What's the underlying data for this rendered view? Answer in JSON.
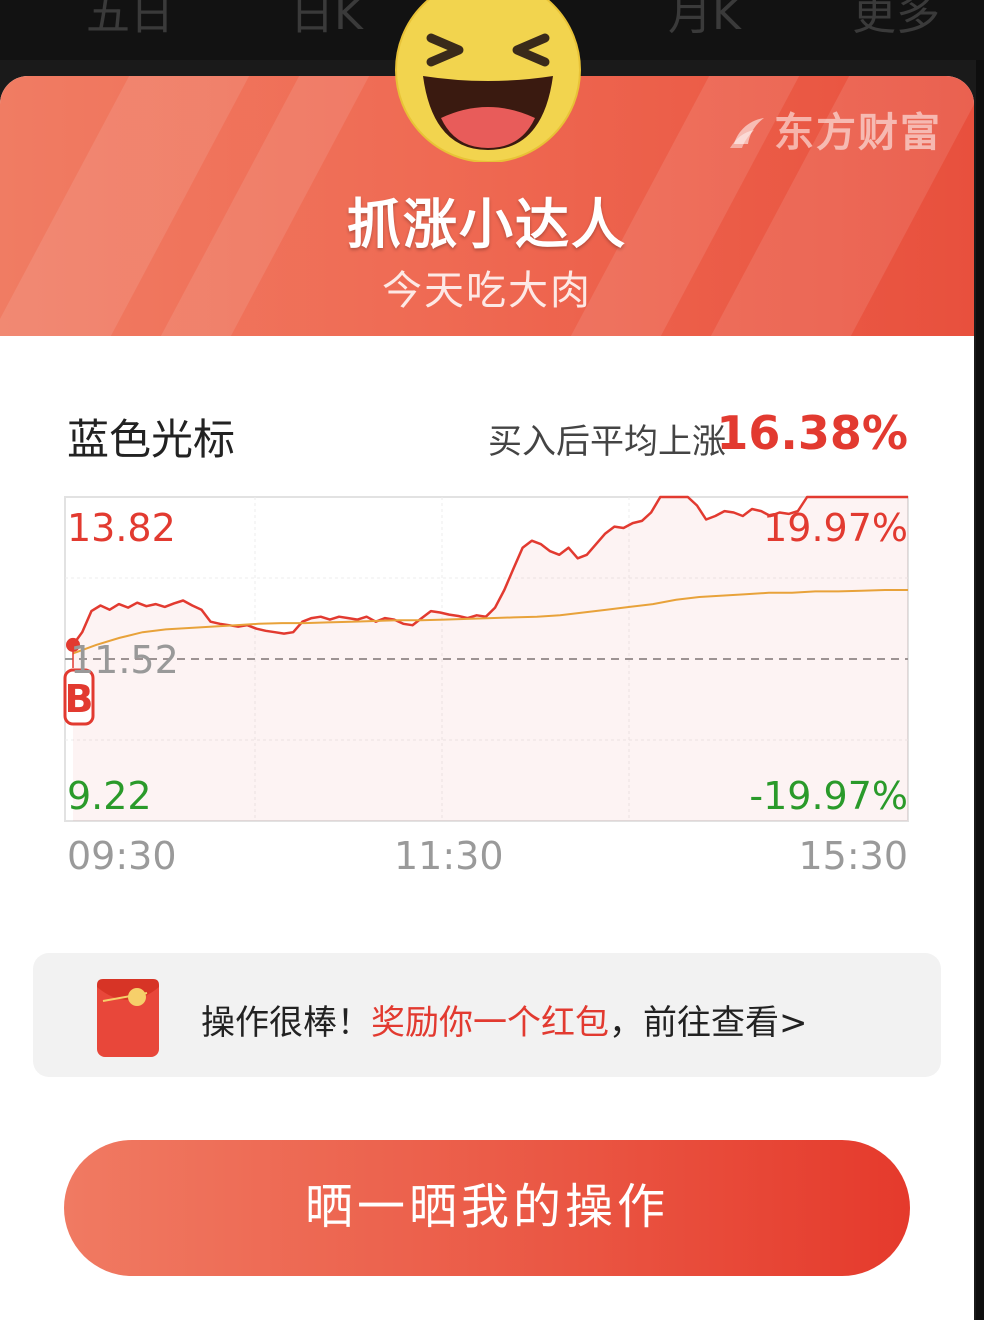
{
  "background_tabs": [
    "五日",
    "日K",
    "月K",
    "更多"
  ],
  "header": {
    "brand": "东方财富",
    "title": "抓涨小达人",
    "subtitle": "今天吃大肉"
  },
  "stock": {
    "name": "蓝色光标",
    "avg_rise_label": "买入后平均上涨",
    "avg_rise_value": "16.38%"
  },
  "chart_data": {
    "type": "line",
    "price_labels": {
      "high": "13.82",
      "base": "11.52",
      "low": "9.22"
    },
    "pct_labels": {
      "high": "19.97%",
      "low": "-19.97%"
    },
    "x_ticks": [
      "09:30",
      "11:30",
      "15:30"
    ],
    "buy_marker": "B",
    "ylim": [
      9.22,
      13.82
    ],
    "series": [
      {
        "values": [
          11.72,
          11.9,
          12.2,
          12.28,
          12.22,
          12.3,
          12.25,
          12.32,
          12.27,
          12.3,
          12.26,
          12.31,
          12.35,
          12.28,
          12.22,
          12.05,
          12.02,
          12.0,
          11.98,
          12.0,
          11.95,
          11.92,
          11.9,
          11.88,
          11.9,
          12.05,
          12.1,
          12.12,
          12.08,
          12.12,
          12.1,
          12.08,
          12.12,
          12.05,
          12.1,
          12.08,
          12.02,
          12.0,
          12.1,
          12.2,
          12.18,
          12.15,
          12.13,
          12.1,
          12.14,
          12.12,
          12.25,
          12.5,
          12.8,
          13.1,
          13.2,
          13.15,
          13.05,
          13.0,
          13.1,
          12.95,
          13.0,
          13.15,
          13.3,
          13.4,
          13.38,
          13.45,
          13.48,
          13.6,
          13.82,
          13.82,
          13.82,
          13.82,
          13.7,
          13.5,
          13.55,
          13.62,
          13.6,
          13.55,
          13.65,
          13.62,
          13.55,
          13.6,
          13.58,
          13.62,
          13.82,
          13.82,
          13.82,
          13.82,
          13.82,
          13.82,
          13.82,
          13.82,
          13.82,
          13.82,
          13.82,
          13.82
        ],
        "color": "#e23a30"
      },
      {
        "values": [
          11.6,
          11.72,
          11.82,
          11.9,
          11.94,
          11.96,
          11.98,
          12.0,
          12.02,
          12.03,
          12.03,
          12.04,
          12.05,
          12.06,
          12.07,
          12.07,
          12.08,
          12.09,
          12.1,
          12.11,
          12.12,
          12.14,
          12.18,
          12.22,
          12.26,
          12.3,
          12.36,
          12.4,
          12.42,
          12.44,
          12.46,
          12.46,
          12.48,
          12.48,
          12.49,
          12.5,
          12.5
        ],
        "color": "#e8a23a"
      }
    ]
  },
  "reward": {
    "part1": "操作很棒！",
    "part2": "奖励你一个红包",
    "part3": "，前往查看>"
  },
  "share_button": "晒一晒我的操作",
  "colors": {
    "accent": "#e23a30",
    "fall": "#2a9a2a",
    "header_start": "#f07c63",
    "header_end": "#e8503d"
  }
}
